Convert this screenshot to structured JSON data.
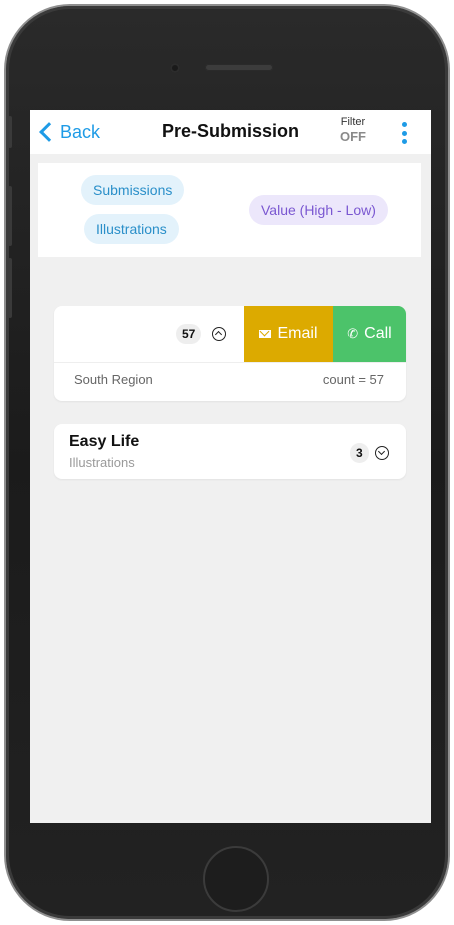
{
  "nav": {
    "back_label": "Back",
    "title": "Pre-Submission",
    "filter_label": "Filter",
    "filter_state": "OFF"
  },
  "chips": {
    "submissions": "Submissions",
    "illustrations": "Illustrations",
    "sort": "Value (High - Low)"
  },
  "groups": [
    {
      "count_badge": "57",
      "expanded": true,
      "email_label": "Email",
      "call_label": "Call",
      "region": "South Region",
      "count_text": "count = 57"
    },
    {
      "name": "Easy Life",
      "subtitle": "Illustrations",
      "count_badge": "3",
      "expanded": false
    }
  ],
  "colors": {
    "accent": "#1e9be6",
    "email": "#dcaa00",
    "call": "#4cc36a"
  }
}
